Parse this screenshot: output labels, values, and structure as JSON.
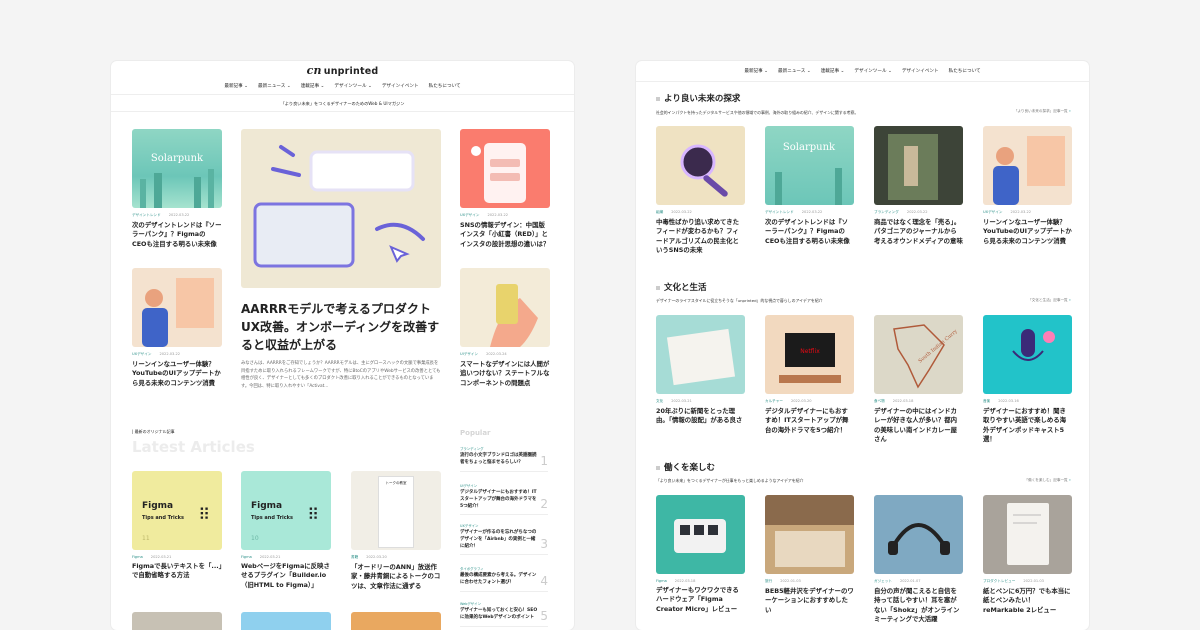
{
  "left": {
    "brand": "unprinted",
    "nav": [
      "最新記事 ⌄",
      "最新ニュース ⌄",
      "連載記事 ⌄",
      "デザインツール ⌄",
      "デザインイベント",
      "私たちについて"
    ],
    "tagline": "「より良い未来」をつくるデザイナーのためのWeb & UIマガジン",
    "hero": {
      "title": "AARRRモデルで考えるプロダクトUX改善。オンボーディングを改善すると収益が上がる",
      "excerpt": "みなさんは、AARRRをご存知でしょうか？AARRRモデルは、主にグロースハックの文脈で事業成長を目指すために取り入れられるフレームワークですが、特にBtoCのアプリやWebサービスの改善ととても相性が良く、デザイナーとしても多くのプロダクト改善に取り入れることができるものとなっています。今回は、特に取り入れやすい「Activat..."
    },
    "cards": [
      {
        "cat": "デザイントレンド",
        "date": "2022.03.22",
        "title": "次のデザイントレンドは『ソーラーパンク』？Figmaの CEOも注目する明るい未来像",
        "img": "Solarpunk"
      },
      {
        "cat": "UXデザイン",
        "date": "2022.03.22",
        "title": "SNSの情報デザイン：中国版インスタ「小紅書（RED）」とインスタの設計思想の違いは？"
      },
      {
        "cat": "UXデザイン",
        "date": "2022.03.22",
        "title": "リーンインなユーザー体験？YouTubeのUIアップデートから見る未来のコンテンツ消費"
      },
      {
        "cat": "UIデザイン",
        "date": "2022.03.24",
        "title": "スマートなデザインには人間が追いつけない？ステートフルなコンポーネントの問題点"
      }
    ],
    "section_label": "| 最新のオリジナル記事",
    "latest_heading": "Latest Articles",
    "popular_heading": "Popular",
    "latest": [
      {
        "cat": "Figma",
        "date": "2022.03.21",
        "title": "Figmaで長いテキストを「...」で自動省略する方法",
        "img_title": "Figma",
        "img_sub": "Tips and Tricks",
        "img_num": "11"
      },
      {
        "cat": "Figma",
        "date": "2022.03.21",
        "title": "WebページをFigmaに反映させるプラグイン「Builder.io（旧HTML to Figma）」",
        "img_title": "Figma",
        "img_sub": "Tips and Tricks",
        "img_num": "10"
      },
      {
        "cat": "書籍",
        "date": "2022.03.20",
        "title": "「オードリーのANN」放送作家・藤井青銅によるトークのコツは、文章作法に通ずる",
        "img_title": "トークの教室"
      }
    ],
    "popular": [
      {
        "cat": "ブランディング",
        "title": "流行の小文字ブランドロゴは英語圏読者をちょっと悩ませるらしい？",
        "num": "1"
      },
      {
        "cat": "UIデザイン",
        "title": "デジタルデザイナーにもおすすめ！ITスタートアップが舞台の海外ドラマを5つ紹介！",
        "num": "2"
      },
      {
        "cat": "UXデザイン",
        "title": "デザイナーが作るのを忘れがちなつのデザインを「Airbnb」の実例と一緒に紹介！",
        "num": "3"
      },
      {
        "cat": "タイポグラフィ",
        "title": "最後の構成要素から考える。デザインに合わせたフォント選び！",
        "num": "4"
      },
      {
        "cat": "Webデザイン",
        "title": "デザイナーも知っておくと安心！SEOに効果的なWebデザインのポイント",
        "num": "5"
      }
    ]
  },
  "right": {
    "nav": [
      "最新記事 ⌄",
      "最新ニュース ⌄",
      "連載記事 ⌄",
      "デザインツール ⌄",
      "デザインイベント",
      "私たちについて"
    ],
    "sections": [
      {
        "heading": "より良い未来の探求",
        "desc": "社会的インパクトを持ったデジタルサービスや他の領域での事例、海外の取り組みの紹介、デザインに関する考察。",
        "link": "「より良い未来の探求」記事一覧",
        "items": [
          {
            "cat": "組織",
            "date": "2022.03.22",
            "title": "中毒性ばかり追い求めてきたフィードが変わるかも？フィードアルゴリズムの民主化というSNSの未来"
          },
          {
            "cat": "デザイントレンド",
            "date": "2022.03.22",
            "title": "次のデザイントレンドは『ソーラーパンク』？Figmaの CEOも注目する明るい未来像",
            "img": "Solarpunk"
          },
          {
            "cat": "ブランディング",
            "date": "2022.03.22",
            "title": "商品ではなく理念を「売る」。パタゴニアのジャーナルから考えるオウンドメディアの意味"
          },
          {
            "cat": "UXデザイン",
            "date": "2022.03.22",
            "title": "リーンインなユーザー体験？YouTubeのUIアップデートから見る未来のコンテンツ消費"
          }
        ]
      },
      {
        "heading": "文化と生活",
        "desc": "デザイナーのライフスタイルに役立ちそうな「unprinted」的な視点で暮らしのアイデアを紹介",
        "link": "「文化と生活」記事一覧",
        "items": [
          {
            "cat": "文化",
            "date": "2022.03.21",
            "title": "20年ぶりに新聞をとった理由。「情報の設配」がある良さ"
          },
          {
            "cat": "カルチャー",
            "date": "2022.03.20",
            "title": "デジタルデザイナーにもおすすめ！ITスタートアップが舞台の海外ドラマを5つ紹介！",
            "img": "Netflix"
          },
          {
            "cat": "食べ物",
            "date": "2022.03.18",
            "title": "デザイナーの中にはインドカレーが好きな人が多い？都内の美味しい南インドカレー屋さん",
            "img": "South Indian Curry"
          },
          {
            "cat": "音楽",
            "date": "2022.03.16",
            "title": "デザイナーにおすすめ！聞き取りやすい英語で楽しめる海外デザインポッドキャスト5選！"
          }
        ]
      },
      {
        "heading": "働くを楽しむ",
        "desc": "「より良い未来」をつくるデザイナーが仕事をもっと楽しめるようなアイデアを紹介",
        "link": "「働くを楽しむ」記事一覧",
        "items": [
          {
            "cat": "Figma",
            "date": "2022.03.18",
            "title": "デザイナーもワクワクできるハードウェア「Figma Creator Micro」レビュー"
          },
          {
            "cat": "旅行",
            "date": "2022.01.03",
            "title": "BEB5軽井沢をデザイナーのワーケーションにおすすめしたい"
          },
          {
            "cat": "ガジェット",
            "date": "2022.01.07",
            "title": "自分の声が聞こえると自信を持って話しやすい！耳を塞がない「Shokz」がオンラインミーティングで大活躍"
          },
          {
            "cat": "プロダクトレビュー",
            "date": "2022.01.03",
            "title": "紙とペンに6万円？でも本当に紙とペンみたい！reMarkable 2レビュー"
          }
        ]
      }
    ]
  }
}
